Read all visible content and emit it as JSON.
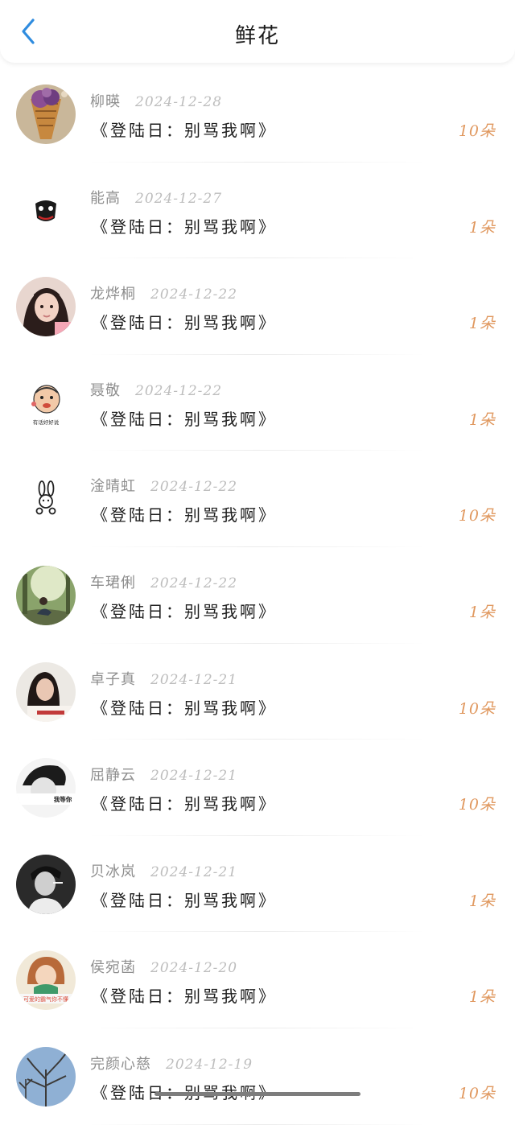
{
  "header": {
    "title": "鲜花",
    "back_icon": "chevron-left-icon",
    "accent_color": "#2f8cdf"
  },
  "gift_color": "#e0985f",
  "records": [
    {
      "name": "柳暎",
      "date": "2024-12-28",
      "message": "《登陆日：别骂我啊》",
      "count": "10朵",
      "avatar": "ice-cream-waffle"
    },
    {
      "name": "能高",
      "date": "2024-12-27",
      "message": "《登陆日：别骂我啊》",
      "count": "1朵",
      "avatar": "joker-mask"
    },
    {
      "name": "龙烨桐",
      "date": "2024-12-22",
      "message": "《登陆日：别骂我啊》",
      "count": "1朵",
      "avatar": "girl-portrait"
    },
    {
      "name": "聂敬",
      "date": "2024-12-22",
      "message": "《登陆日：别骂我啊》",
      "count": "1朵",
      "avatar": "cartoon-face-meme"
    },
    {
      "name": "淦晴虹",
      "date": "2024-12-22",
      "message": "《登陆日：别骂我啊》",
      "count": "10朵",
      "avatar": "bunny-doodle"
    },
    {
      "name": "车珺俐",
      "date": "2024-12-22",
      "message": "《登陆日：别骂我啊》",
      "count": "1朵",
      "avatar": "forest-person"
    },
    {
      "name": "卓子真",
      "date": "2024-12-21",
      "message": "《登陆日：别骂我啊》",
      "count": "10朵",
      "avatar": "girl-shirt"
    },
    {
      "name": "屈静云",
      "date": "2024-12-21",
      "message": "《登陆日：别骂我啊》",
      "count": "10朵",
      "avatar": "boy-bw"
    },
    {
      "name": "贝冰岚",
      "date": "2024-12-21",
      "message": "《登陆日：别骂我啊》",
      "count": "1朵",
      "avatar": "man-dark"
    },
    {
      "name": "侯宛菡",
      "date": "2024-12-20",
      "message": "《登陆日：别骂我啊》",
      "count": "1朵",
      "avatar": "girl-meme"
    },
    {
      "name": "完颜心慈",
      "date": "2024-12-19",
      "message": "《登陆日：别骂我啊》",
      "count": "10朵",
      "avatar": "winter-trees"
    }
  ],
  "avatar_texts": {
    "cartoon-face-meme": "有话好好说",
    "boy-bw": "我等你",
    "girl-meme": "可爱的霸气你不懂"
  }
}
